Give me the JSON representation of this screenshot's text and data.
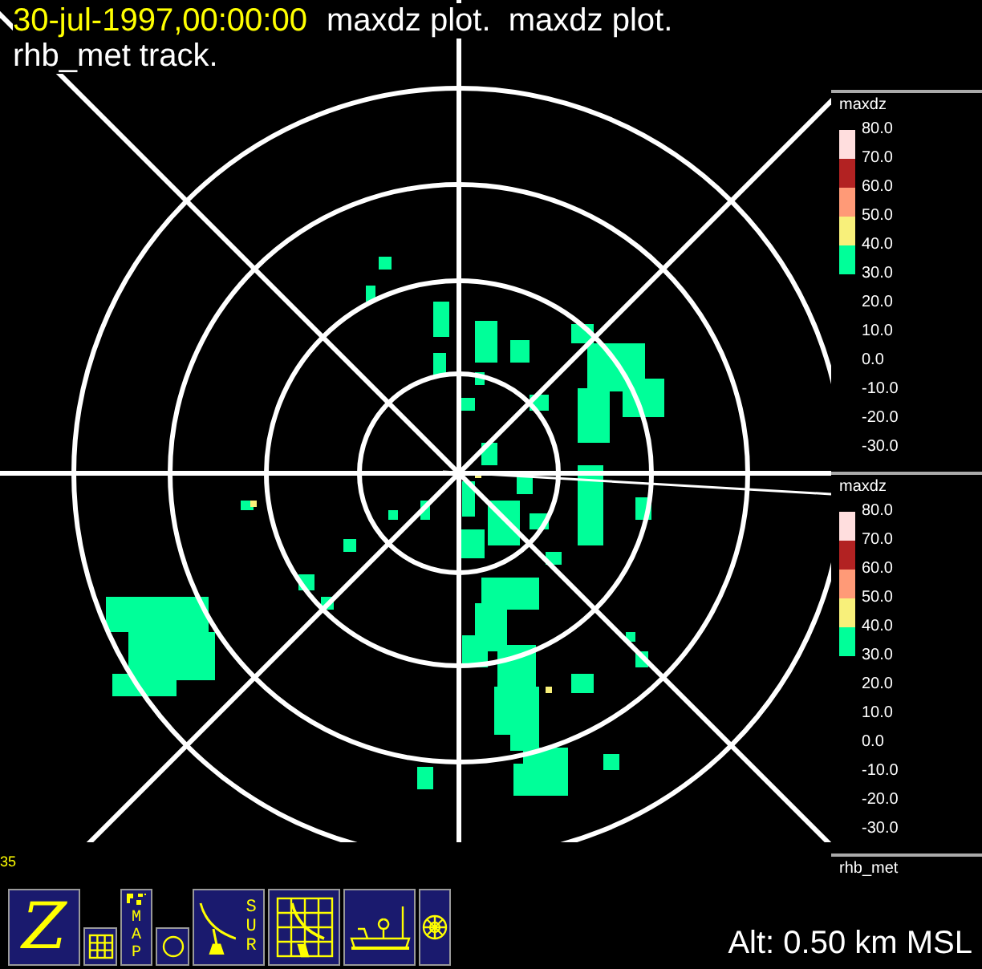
{
  "title": {
    "timestamp": "30-jul-1997,00:00:00",
    "text": "maxdz plot.  maxdz plot.",
    "line2": "rhb_met track."
  },
  "legends": [
    {
      "title": "maxdz",
      "bins": [
        {
          "color": "#ffdede"
        },
        {
          "color": "#b22222"
        },
        {
          "color": "#ff9a77"
        },
        {
          "color": "#f8f07a"
        },
        {
          "color": "#00ff99"
        }
      ],
      "labels": [
        "80.0",
        "70.0",
        "60.0",
        "50.0",
        "40.0",
        "30.0",
        "20.0",
        "10.0",
        "0.0",
        "-10.0",
        "-20.0",
        "-30.0"
      ]
    },
    {
      "title": "maxdz",
      "bins": [
        {
          "color": "#ffdede"
        },
        {
          "color": "#b22222"
        },
        {
          "color": "#ff9a77"
        },
        {
          "color": "#f8f07a"
        },
        {
          "color": "#00ff99"
        }
      ],
      "labels": [
        "80.0",
        "70.0",
        "60.0",
        "50.0",
        "40.0",
        "30.0",
        "20.0",
        "10.0",
        "0.0",
        "-10.0",
        "-20.0",
        "-30.0"
      ],
      "footer": "rhb_met"
    }
  ],
  "corner_label": "35",
  "toolbar": [
    {
      "kind": "z",
      "label": "Z"
    },
    {
      "kind": "grid"
    },
    {
      "kind": "map",
      "label": "MAP"
    },
    {
      "kind": "circle"
    },
    {
      "kind": "sur",
      "label": "SUR"
    },
    {
      "kind": "gridradar"
    },
    {
      "kind": "ship"
    },
    {
      "kind": "wheel"
    }
  ],
  "status": "Alt: 0.50 km MSL"
}
